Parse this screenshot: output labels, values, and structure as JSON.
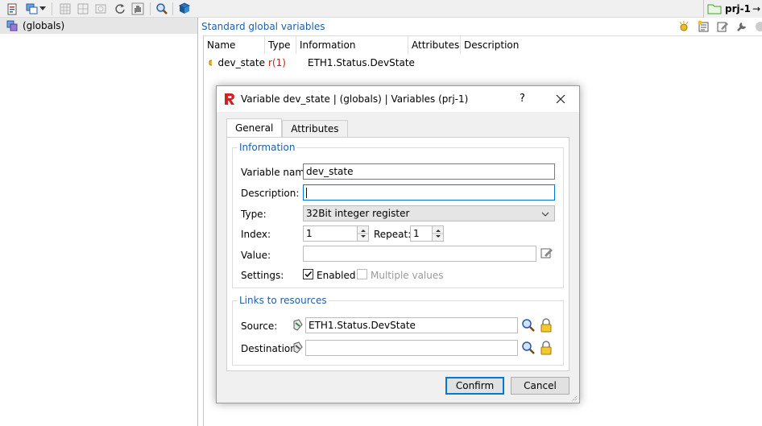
{
  "toolbar": {
    "project_label": "prj-1",
    "arrow": "→"
  },
  "tree": {
    "items": [
      {
        "label": "(globals)"
      }
    ]
  },
  "variables_panel": {
    "title": "Standard global variables",
    "columns": [
      "Name",
      "Type",
      "Information",
      "Attributes",
      "Description"
    ],
    "rows": [
      {
        "name": "dev_state",
        "type": "r(1)",
        "information": "ETH1.Status.DevState",
        "attributes": "",
        "description": ""
      }
    ]
  },
  "dialog": {
    "title": "Variable dev_state | (globals) | Variables (prj-1)",
    "help": "?",
    "tabs": [
      "General",
      "Attributes"
    ],
    "information_group": "Information",
    "labels": {
      "variable_name": "Variable name:",
      "description": "Description:",
      "type": "Type:",
      "index": "Index:",
      "repeat": "Repeat:",
      "value": "Value:",
      "settings": "Settings:",
      "enabled": "Enabled",
      "multiple_values": "Multiple values"
    },
    "fields": {
      "variable_name": "dev_state",
      "description": "",
      "type": "32Bit integer register",
      "index": "1",
      "repeat": "1",
      "value": ""
    },
    "enabled_checked": true,
    "multiple_values_checked": false,
    "links_group": "Links to resources",
    "links_labels": {
      "source": "Source:",
      "destination": "Destination:"
    },
    "links": {
      "source": "ETH1.Status.DevState",
      "destination": ""
    },
    "buttons": {
      "confirm": "Confirm",
      "cancel": "Cancel"
    }
  },
  "colors": {
    "accent": "#1f5fa8",
    "focus": "#0078d7",
    "logo_red": "#d42020"
  }
}
